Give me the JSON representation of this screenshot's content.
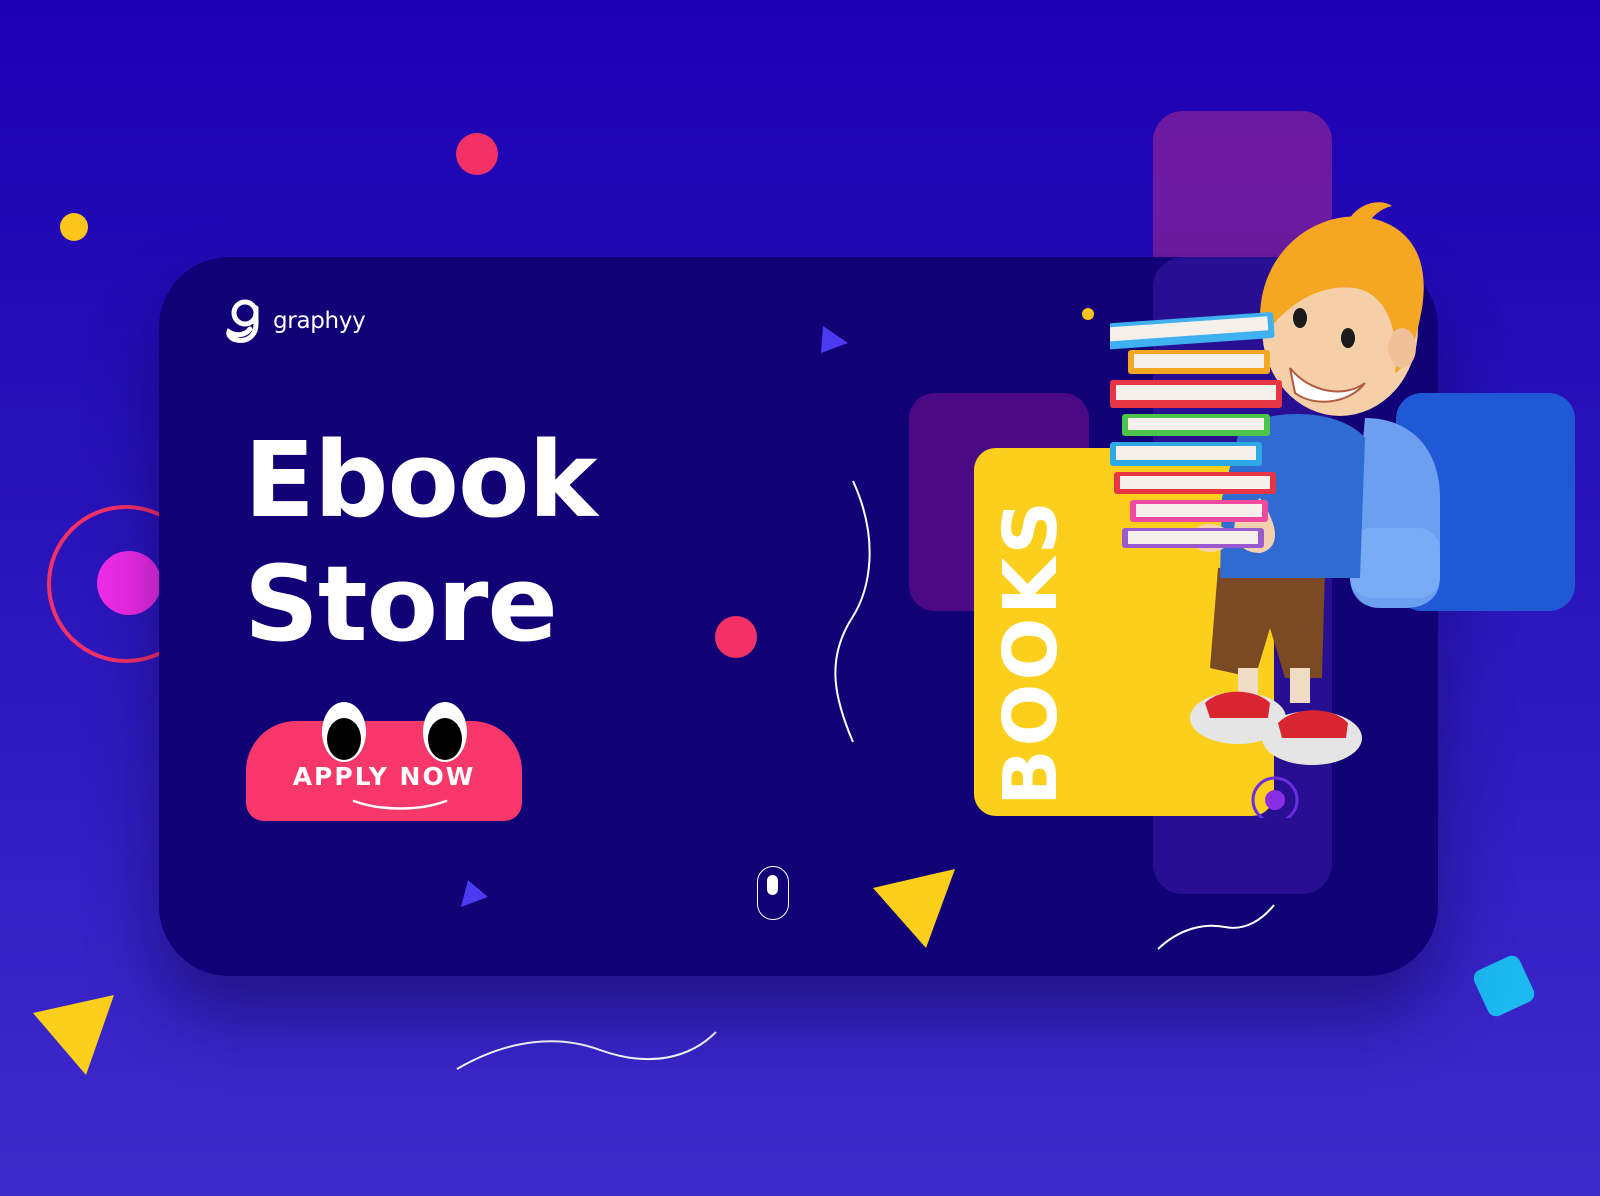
{
  "brand": {
    "name": "graphyy",
    "logo_icon": "graphyy-g-logo-icon"
  },
  "hero": {
    "title_line_1": "Ebook",
    "title_line_2": "Store"
  },
  "cta": {
    "label": "APPLY NOW"
  },
  "books_panel": {
    "label": "BOOKS"
  },
  "scroll_indicator": {
    "icon": "mouse-scroll-icon"
  },
  "illustration": {
    "subject": "3d-boy-carrying-books-illustration"
  },
  "colors": {
    "background": "#1e00b3",
    "card": "#120077",
    "cta": "#f8376a",
    "books_panel": "#fccf1c",
    "accent_pink": "#f43167",
    "accent_magenta": "#f02ce8",
    "accent_yellow": "#fccf1c",
    "accent_cyan": "#1bb9f0",
    "accent_purple": "#7b1a9a",
    "accent_blue": "#2060d8"
  }
}
